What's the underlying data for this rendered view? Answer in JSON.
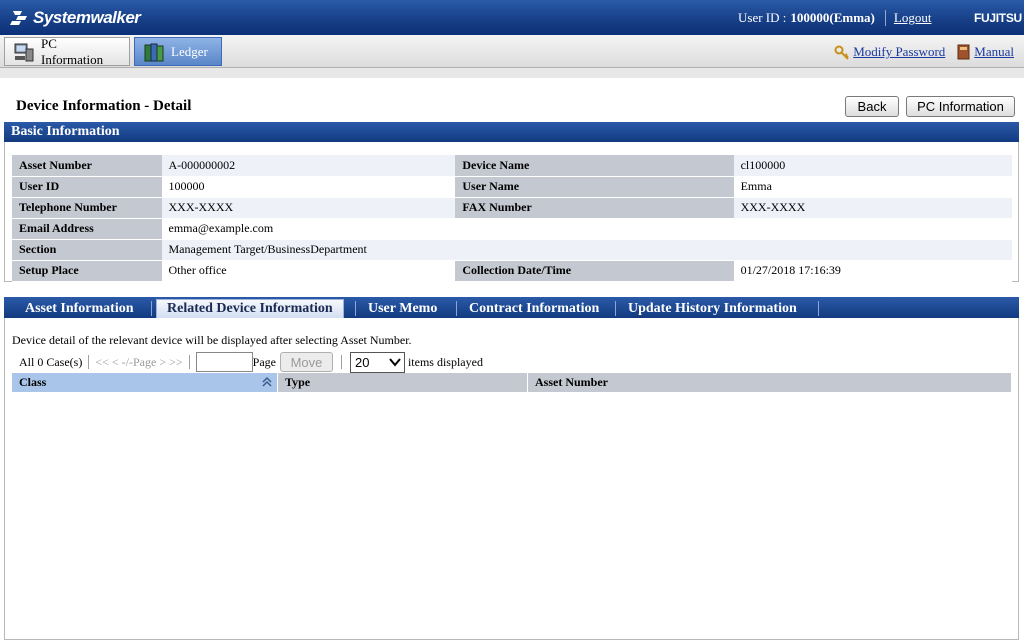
{
  "header": {
    "app_name": "Systemwalker",
    "user_id_label": "User ID :",
    "user_id_value": "100000(Emma)",
    "logout_label": "Logout",
    "vendor": "FUJITSU"
  },
  "nav": {
    "tabs": [
      {
        "label": "PC Information",
        "icon": "pc-icon",
        "active": false
      },
      {
        "label": "Ledger",
        "icon": "ledger-icon",
        "active": true
      }
    ],
    "modify_password_label": "Modify Password",
    "manual_label": "Manual"
  },
  "page": {
    "title": "Device Information - Detail",
    "back_label": "Back",
    "pc_info_label": "PC Information"
  },
  "basic": {
    "title": "Basic Information",
    "rows": [
      {
        "l1": "Asset Number",
        "v1": "A-000000002",
        "l2": "Device Name",
        "v2": "cl100000"
      },
      {
        "l1": "User ID",
        "v1": "100000",
        "l2": "User Name",
        "v2": "Emma"
      },
      {
        "l1": "Telephone Number",
        "v1": "XXX-XXXX",
        "l2": "FAX Number",
        "v2": "XXX-XXXX"
      },
      {
        "l1": "Email Address",
        "v1": "emma@example.com",
        "l2": "",
        "v2": ""
      },
      {
        "l1": "Section",
        "v1": "Management Target/BusinessDepartment",
        "l2": "",
        "v2": ""
      },
      {
        "l1": "Setup Place",
        "v1": "Other office",
        "l2": "Collection Date/Time",
        "v2": "01/27/2018 17:16:39"
      }
    ]
  },
  "tabs": {
    "items": [
      {
        "label": "Asset Information"
      },
      {
        "label": "Related Device Information"
      },
      {
        "label": "User Memo"
      },
      {
        "label": "Contract Information"
      },
      {
        "label": "Update History Information"
      }
    ],
    "active_index": 1
  },
  "related": {
    "description": "Device detail of the relevant device will be displayed after selecting Asset Number.",
    "count_label": "All 0 Case(s)",
    "first": "<<",
    "prev": "<",
    "page_indicator": "-/-Page",
    "next": ">",
    "last": ">>",
    "page_label": "Page",
    "page_input_value": "",
    "move_label": "Move",
    "per_page_value": "20",
    "items_displayed_label": "items displayed",
    "columns": [
      "Class",
      "Type",
      "Asset Number"
    ],
    "rows": []
  },
  "colors": {
    "header_blue": "#163e86",
    "active_tab": "#5a86c8",
    "label_bg": "#c4c8d0",
    "sorted_col": "#a9c5ea"
  }
}
